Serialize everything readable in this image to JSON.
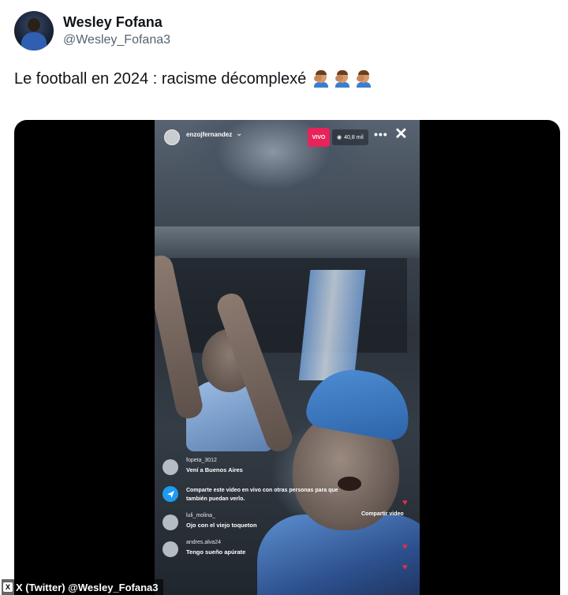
{
  "tweet": {
    "display_name": "Wesley Fofana",
    "handle": "@Wesley_Fofana3",
    "text": "Le football en 2024 : racisme décomplexé",
    "emojis": [
      "man-facepalming-emoji",
      "man-facepalming-emoji",
      "man-facepalming-emoji"
    ]
  },
  "live": {
    "username": "enzojfernandez",
    "live_badge": "VIVO",
    "viewers": "40,8 mil",
    "more_label": "•••",
    "close_label": "✕",
    "share_link": "Compartir video",
    "comments": [
      {
        "user": "fopeta_3012",
        "text": "Vení a Buenos Aires"
      },
      {
        "user": "",
        "text": "Comparte este video en vivo con otras personas para que también puedan verlo."
      },
      {
        "user": "luli_molina_",
        "text": "Ojo con el viejo toqueton"
      },
      {
        "user": "andres.alva24",
        "text": "Tengo sueño apúrate"
      }
    ]
  },
  "credit": {
    "text": "X (Twitter) @Wesley_Fofana3",
    "logo": "X"
  }
}
